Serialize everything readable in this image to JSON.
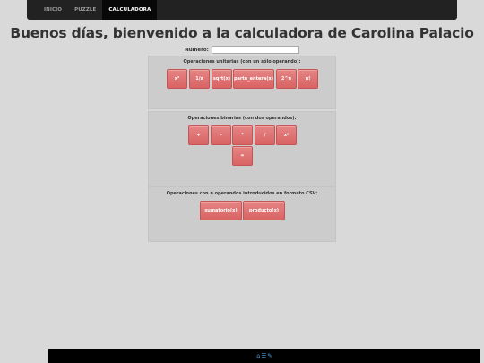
{
  "nav": {
    "items": [
      {
        "label": "INICIO"
      },
      {
        "label": "PUZZLE"
      },
      {
        "label": "CALCULADORA"
      }
    ]
  },
  "title": "Buenos días, bienvenido a la calculadora de Carolina Palacio",
  "numero": {
    "label": "Número:",
    "value": ""
  },
  "unary": {
    "heading": "Operaciones unitarias (con un sólo operando):",
    "buttons": [
      "x²",
      "1/x",
      "sqrt(x)",
      "parte_entera(x)",
      "2^n",
      "n!"
    ]
  },
  "binary": {
    "heading": "Operaciones binarias (con dos operandos):",
    "buttons": [
      "+",
      "-",
      "*",
      "/",
      "xʸ",
      "="
    ]
  },
  "nary": {
    "heading": "Operaciones con n operandos introducidos en formato CSV:",
    "buttons": [
      "sumatorio(x)",
      "producto(x)"
    ]
  },
  "footer": {
    "icons": [
      "home-icon",
      "list-icon",
      "pencil-icon"
    ],
    "accent": "#4aa3df"
  },
  "colors": {
    "button": "#dc6b6b",
    "nav": "#222222",
    "background": "#d9d9d9"
  }
}
